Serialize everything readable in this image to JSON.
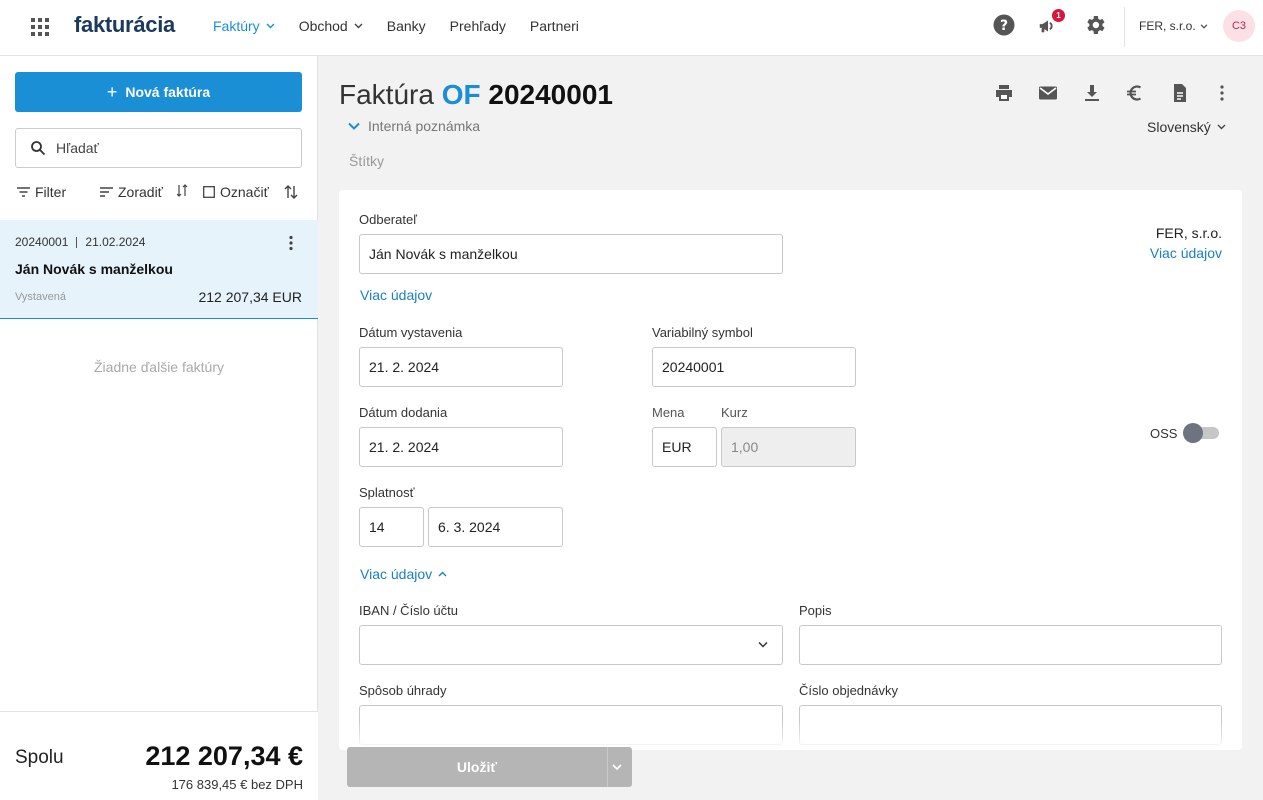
{
  "app": {
    "logo": "fakturácia"
  },
  "nav": {
    "items": [
      {
        "label": "Faktúry",
        "active": true,
        "has_dropdown": true
      },
      {
        "label": "Obchod",
        "active": false,
        "has_dropdown": true
      },
      {
        "label": "Banky",
        "active": false,
        "has_dropdown": false
      },
      {
        "label": "Prehľady",
        "active": false,
        "has_dropdown": false
      },
      {
        "label": "Partneri",
        "active": false,
        "has_dropdown": false
      }
    ],
    "notification_count": "1",
    "company": "FER, s.r.o.",
    "avatar_initials": "C3",
    "icons": [
      "apps-grid-icon",
      "help-icon",
      "megaphone-icon",
      "settings-gear-icon"
    ]
  },
  "sidebar": {
    "new_invoice": "Nová faktúra",
    "search_placeholder": "Hľadať",
    "filter": "Filter",
    "sort": "Zoradiť",
    "select": "Označiť",
    "invoice": {
      "number": "20240001",
      "date": "21.02.2024",
      "customer": "Ján Novák s manželkou",
      "status": "Vystavená",
      "amount": "212 207,34 EUR"
    },
    "empty_text": "Žiadne ďalšie faktúry",
    "total_label": "Spolu",
    "total_amount": "212 207,34 €",
    "total_without_vat": "176 839,45 € bez DPH"
  },
  "invoice": {
    "title_prefix": "Faktúra",
    "series": "OF",
    "number": "20240001",
    "internal_note": "Interná poznámka",
    "language": "Slovenský",
    "tags": "Štítky",
    "actions": [
      "print-icon",
      "email-icon",
      "download-icon",
      "euro-icon",
      "document-icon",
      "more-vertical-icon"
    ]
  },
  "form": {
    "customer_label": "Odberateľ",
    "customer_value": "Ján Novák s manželkou",
    "more_details": "Viac údajov",
    "supplier_name": "FER, s.r.o.",
    "supplier_more": "Viac údajov",
    "issue_date_label": "Dátum vystavenia",
    "issue_date": "21. 2. 2024",
    "var_symbol_label": "Variabilný symbol",
    "var_symbol": "20240001",
    "delivery_date_label": "Dátum dodania",
    "delivery_date": "21. 2. 2024",
    "currency_label": "Mena",
    "currency": "EUR",
    "rate_label": "Kurz",
    "rate": "1,00",
    "oss_label": "OSS",
    "oss_enabled": false,
    "due_label": "Splatnosť",
    "due_days": "14",
    "due_date": "6. 3. 2024",
    "more_details_expanded": "Viac údajov",
    "iban_label": "IBAN / Číslo účtu",
    "iban": "",
    "description_label": "Popis",
    "description": "",
    "payment_method_label": "Spôsob úhrady",
    "payment_method": "",
    "order_number_label": "Číslo objednávky",
    "order_number": ""
  },
  "footer": {
    "save": "Uložiť"
  },
  "colors": {
    "accent": "#1a8fd6",
    "link": "#1a7fc4",
    "badge": "#d8143a",
    "save_disabled": "#b5b5b5"
  }
}
